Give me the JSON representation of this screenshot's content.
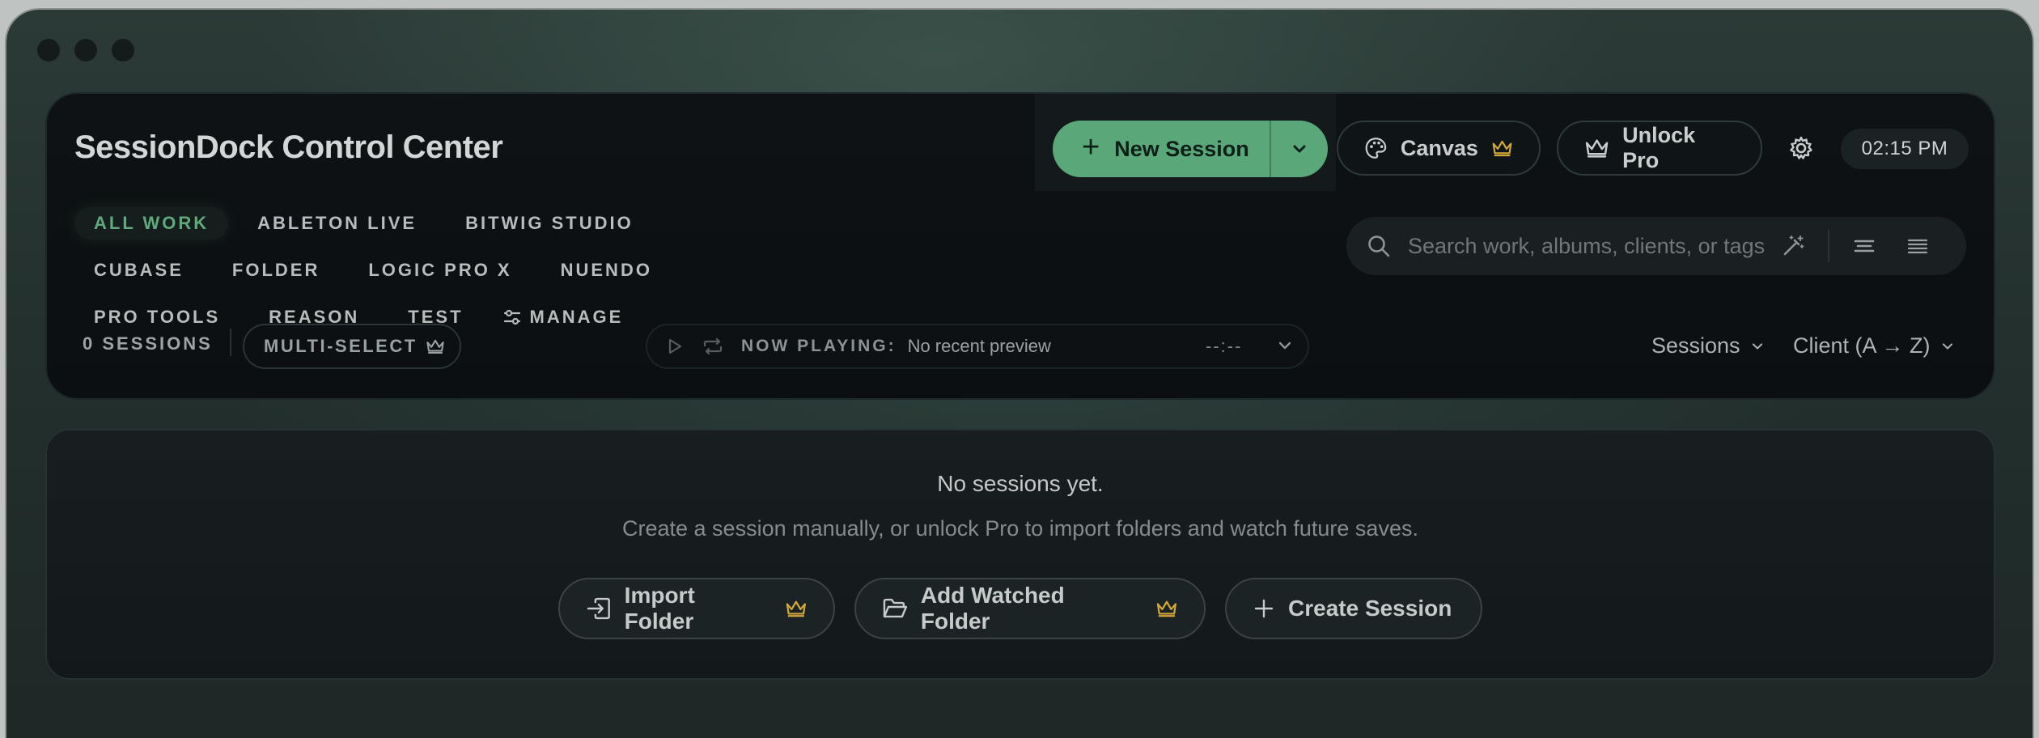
{
  "app": {
    "title": "SessionDock Control Center",
    "accent_color": "#5aa879",
    "pro_color": "#d4a93b"
  },
  "toolbar": {
    "new_session_label": "New Session",
    "canvas_label": "Canvas",
    "unlock_pro_label": "Unlock Pro",
    "clock": "02:15 PM"
  },
  "tabs": [
    {
      "label": "ALL WORK",
      "active": true
    },
    {
      "label": "ABLETON LIVE"
    },
    {
      "label": "BITWIG STUDIO"
    },
    {
      "label": "CUBASE"
    },
    {
      "label": "FOLDER"
    },
    {
      "label": "LOGIC PRO X"
    },
    {
      "label": "NUENDO"
    },
    {
      "label": "PRO TOOLS"
    },
    {
      "label": "REASON"
    },
    {
      "label": "TEST"
    }
  ],
  "manage_label": "MANAGE",
  "search": {
    "placeholder": "Search work, albums, clients, or tags"
  },
  "status": {
    "sessions_count": "0 SESSIONS",
    "multi_select_label": "MULTI-SELECT"
  },
  "now_playing": {
    "label": "NOW PLAYING:",
    "text": "No recent preview",
    "time": "--:--"
  },
  "view": {
    "group_by": "Sessions",
    "sort_by": "Client (A → Z)"
  },
  "empty_state": {
    "title": "No sessions yet.",
    "subtitle": "Create a session manually, or unlock Pro to import folders and watch future saves.",
    "import_folder_label": "Import Folder",
    "add_watched_label": "Add Watched Folder",
    "create_session_label": "Create Session"
  },
  "icons": [
    "plus-icon",
    "chevron-down-icon",
    "palette-icon",
    "crown-icon",
    "gear-icon",
    "search-icon",
    "magic-wand-icon",
    "list-view-icon",
    "compact-list-icon",
    "sliders-icon",
    "play-icon",
    "repeat-icon",
    "import-icon",
    "folder-open-icon"
  ]
}
